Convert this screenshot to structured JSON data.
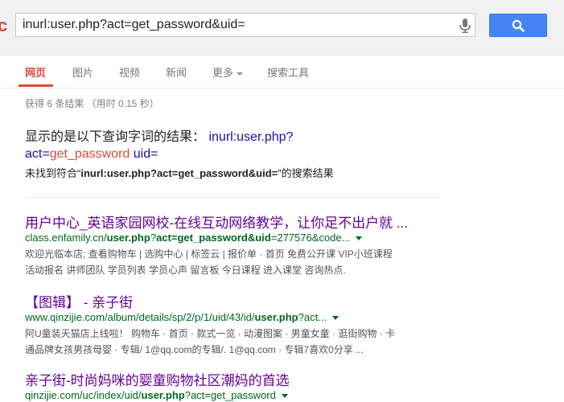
{
  "header": {
    "logo_fragment": "c",
    "search": {
      "value": "inurl:user.php?act=get_password&uid=",
      "placeholder": ""
    },
    "icons": {
      "mic": "microphone-icon",
      "search": "search-icon"
    },
    "accent_color": "#4585f3"
  },
  "tabs": {
    "items": [
      {
        "label": "网页",
        "active": true
      },
      {
        "label": "图片"
      },
      {
        "label": "视频"
      },
      {
        "label": "新闻"
      },
      {
        "label": "更多"
      },
      {
        "label": "搜索工具"
      }
    ],
    "active_color": "#dd4b39"
  },
  "stats": "获得 6 条结果 （用时 0.15 秒）",
  "notice": {
    "prefix": "显示的是以下查询字词的结果：",
    "q1": "inurl:user.php?",
    "q2": "act=",
    "q3": "get_password",
    "q4": "uid=",
    "notfound_prefix": "未找到符合“",
    "notfound_query": "inurl:user.php?act=get_password&uid=",
    "notfound_suffix": "”的搜索结果"
  },
  "results": [
    {
      "title": "用户中心_英语家园网校-在线互动网络教学，让你足不出户就 ...",
      "url_pre": "class.enfamily.cn/",
      "url_bold": "user.php",
      "url_mid": "?",
      "url_bold2": "act=get_password&uid",
      "url_post": "=277576&code...",
      "snippet_line1": "欢迎光临本店; 查看购物车 | 选购中心 | 标签云 | 报价单 · 首页 免费公开课 VIP小班课程",
      "snippet_line2": "活动报名 讲师团队 学员列表 学员心声 留言板 今日课程 进入课堂 咨询热点."
    },
    {
      "title": "【图辑】 - 亲子街",
      "url_pre": "www.qinzijie.com/album/details/sp/2/p/1/uid/43/id/",
      "url_bold": "user.php",
      "url_post": "?act...",
      "snippet_line1": "阿U童装天猫店上线啦！ 购物车 · 首页 · 款式一览 · 动漫图案 · 男童女童 · 逛街购物 · 卡",
      "snippet_line2": "通品牌女孩男孩母婴 · 专辑/ 1@qq.com的专辑/. 1@qq.com · 专辑7喜欢0分享 ..."
    },
    {
      "title": "亲子街-时尚妈咪的婴童购物社区潮妈的首选",
      "url_pre": "qinzijie.com/uc/index/uid/",
      "url_bold": "user.php",
      "url_post": "?act=get_password"
    }
  ]
}
